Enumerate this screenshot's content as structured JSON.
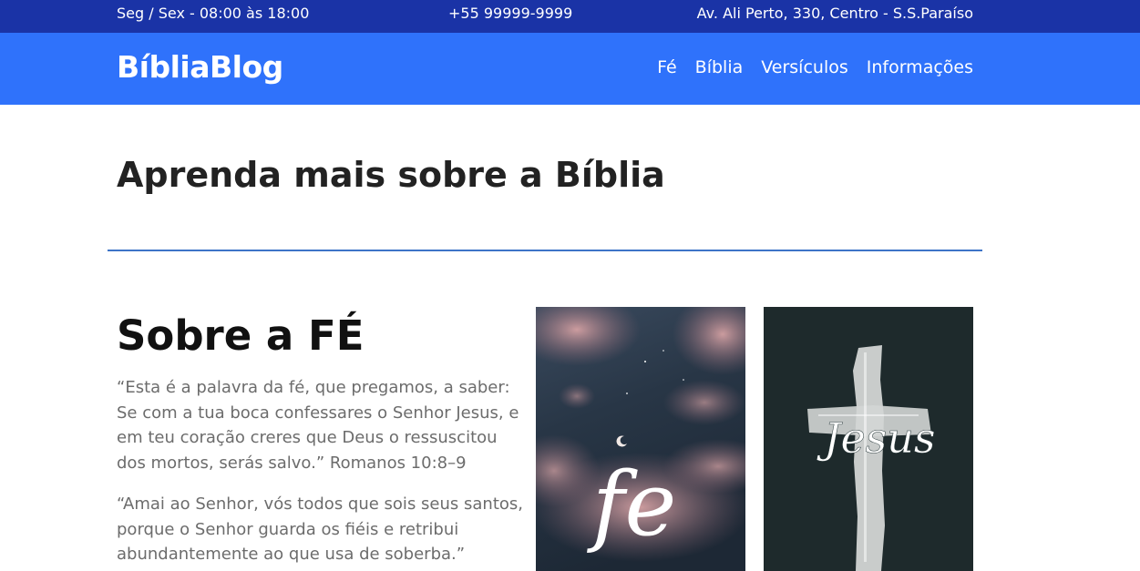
{
  "topbar": {
    "hours": "Seg / Sex - 08:00 às 18:00",
    "phone": "+55 99999-9999",
    "address": "Av. Ali Perto, 330, Centro - S.S.Paraíso"
  },
  "navbar": {
    "brand": "BíbliaBlog",
    "links": [
      "Fé",
      "Bíblia",
      "Versículos",
      "Informações"
    ]
  },
  "main": {
    "title": "Aprenda mais sobre a Bíblia",
    "section": {
      "title": "Sobre a FÉ",
      "quotes": [
        "“Esta é a palavra da fé, que pregamos, a saber: Se com a tua boca confessares o Senhor Jesus, e em teu coração creres que Deus o ressuscitou dos mortos, serás salvo.” Romanos 10:8–9",
        "“Amai ao Senhor, vós todos que sois seus santos, porque o Senhor guarda os fiéis e retribui abundantemente ao que usa de soberba.”"
      ],
      "images": [
        {
          "text": "fe",
          "icon": "night-sky-clouds-image"
        },
        {
          "text": "Jesus",
          "icon": "cross-image"
        }
      ]
    }
  },
  "colors": {
    "topbar": "#1a33a6",
    "navbar": "#2f72fb",
    "divider": "#3d74c7"
  }
}
